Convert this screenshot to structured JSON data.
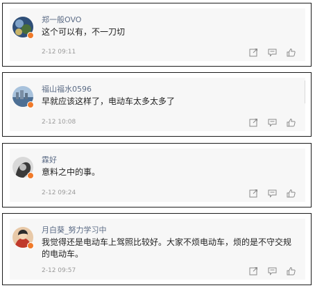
{
  "comments": [
    {
      "username": "郑一般OVO",
      "text": "这个可以有，不一刀切",
      "timestamp": "2-12 09:11"
    },
    {
      "username": "福山福水0596",
      "text": "早就应该这样了，电动车太多太多了",
      "timestamp": "2-12 10:08"
    },
    {
      "username": "霖好",
      "text": "意料之中的事。",
      "timestamp": "2-12 09:24"
    },
    {
      "username": "月白葵_努力学习中",
      "text": "我觉得还是电动车上驾照比较好。大家不烦电动车，烦的是不守交规的电动车。",
      "timestamp": "2-12 09:57"
    }
  ],
  "icons": {
    "share": "share-icon",
    "comment": "comment-icon",
    "like": "like-icon"
  },
  "colors": {
    "username": "#5b6b85",
    "badge": "#f07a2a",
    "border": "#1a1a1a"
  }
}
